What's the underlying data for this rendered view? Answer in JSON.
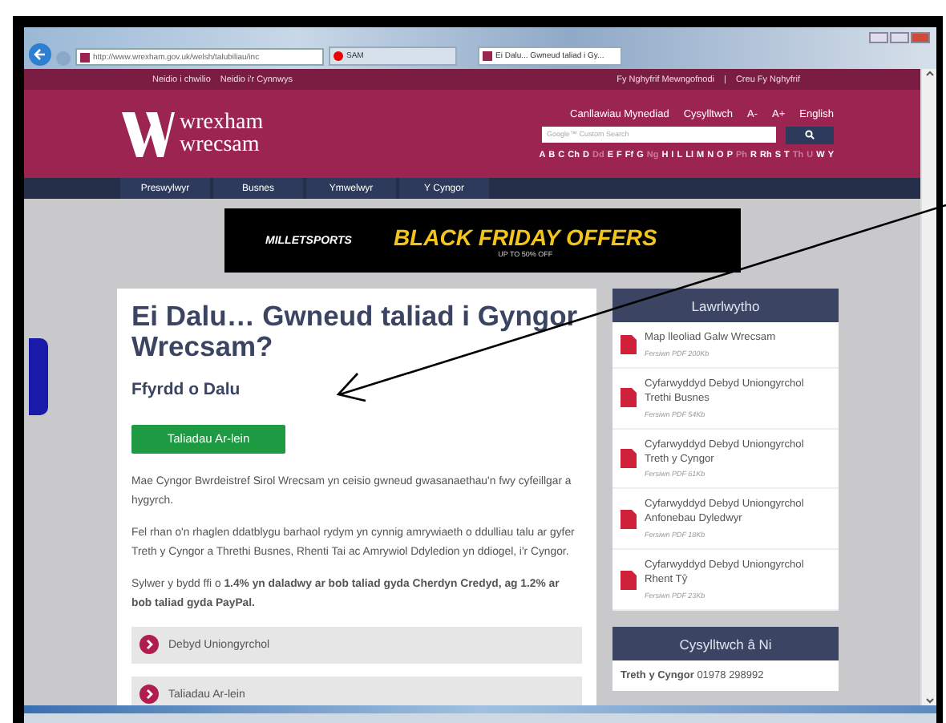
{
  "browser": {
    "address": "http://www.wrexham.gov.uk/welsh/talubiliau/inc",
    "tabs": [
      {
        "label": "SAM",
        "selected": false
      },
      {
        "label": "Ei Dalu... Gwneud taliad i Gy...",
        "selected": true
      }
    ]
  },
  "top_bar": {
    "left_links": [
      "Neidio i chwilio",
      "Neidio i'r Cynnwys"
    ],
    "right_links": [
      "Fy Nghyfrif Mewngofnodi",
      "Creu Fy Nghyfrif"
    ],
    "separator": "|"
  },
  "header": {
    "logo": {
      "line1": "wrexham",
      "line2": "wrecsam"
    },
    "links": [
      "Canllawiau Mynediad",
      "Cysylltwch",
      "A-",
      "A+",
      "English"
    ],
    "search": {
      "placeholder": "Google™ Custom Search"
    },
    "alphabet": [
      {
        "letter": "A",
        "disabled": false
      },
      {
        "letter": "B",
        "disabled": false
      },
      {
        "letter": "C",
        "disabled": false
      },
      {
        "letter": "Ch",
        "disabled": false
      },
      {
        "letter": "D",
        "disabled": false
      },
      {
        "letter": "Dd",
        "disabled": true
      },
      {
        "letter": "E",
        "disabled": false
      },
      {
        "letter": "F",
        "disabled": false
      },
      {
        "letter": "Ff",
        "disabled": false
      },
      {
        "letter": "G",
        "disabled": false
      },
      {
        "letter": "Ng",
        "disabled": true
      },
      {
        "letter": "H",
        "disabled": false
      },
      {
        "letter": "I",
        "disabled": false
      },
      {
        "letter": "L",
        "disabled": false
      },
      {
        "letter": "Ll",
        "disabled": false
      },
      {
        "letter": "M",
        "disabled": false
      },
      {
        "letter": "N",
        "disabled": false
      },
      {
        "letter": "O",
        "disabled": false
      },
      {
        "letter": "P",
        "disabled": false
      },
      {
        "letter": "Ph",
        "disabled": true
      },
      {
        "letter": "R",
        "disabled": false
      },
      {
        "letter": "Rh",
        "disabled": false
      },
      {
        "letter": "S",
        "disabled": false
      },
      {
        "letter": "T",
        "disabled": false
      },
      {
        "letter": "Th",
        "disabled": true
      },
      {
        "letter": "U",
        "disabled": true
      },
      {
        "letter": "W",
        "disabled": false
      },
      {
        "letter": "Y",
        "disabled": false
      }
    ]
  },
  "nav": [
    "Preswylwyr",
    "Busnes",
    "Ymwelwyr",
    "Y Cyngor"
  ],
  "ad": {
    "brand": "MILLETSPORTS",
    "headline": "BLACK FRIDAY OFFERS",
    "subline": "UP TO 50% OFF"
  },
  "main": {
    "title": "Ei Dalu… Gwneud taliad i Gyngor Wrecsam?",
    "subtitle": "Ffyrdd o Dalu",
    "button": "Taliadau Ar-lein",
    "paragraphs": [
      "Mae Cyngor Bwrdeistref Sirol Wrecsam yn ceisio gwneud gwasanaethau'n fwy cyfeillgar a hygyrch.",
      "Fel rhan o'n rhaglen ddatblygu barhaol rydym yn cynnig amrywiaeth o ddulliau talu ar gyfer Treth y Cyngor a Threthi Busnes, Rhenti Tai ac Amrywiol Ddyledion yn ddiogel, i'r Cyngor.",
      "Sylwer y bydd ffi o **1.4% yn daladwy ar bob taliad gyda Cherdyn Credyd, ag 1.2% ar bob taliad gyda PayPal.**"
    ],
    "accordion": [
      "Debyd Uniongyrchol",
      "Taliadau Ar-lein"
    ]
  },
  "downloads": {
    "title": "Lawrlwytho",
    "items": [
      {
        "title": "Map lleoliad Galw Wrecsam",
        "meta": "Fersiwn PDF 200Kb"
      },
      {
        "title": "Cyfarwyddyd Debyd Uniongyrchol Trethi Busnes",
        "meta": "Fersiwn PDF 54Kb"
      },
      {
        "title": "Cyfarwyddyd Debyd Uniongyrchol Treth y Cyngor",
        "meta": "Fersiwn PDF 61Kb"
      },
      {
        "title": "Cyfarwyddyd Debyd Uniongyrchol Anfonebau Dyledwyr",
        "meta": "Fersiwn PDF 18Kb"
      },
      {
        "title": "Cyfarwyddyd Debyd Uniongyrchol Rhent Tŷ",
        "meta": "Fersiwn PDF 23Kb"
      }
    ]
  },
  "contact": {
    "title": "Cysylltwch â Ni",
    "label": "Treth y Cyngor",
    "phone": "01978 298992"
  }
}
